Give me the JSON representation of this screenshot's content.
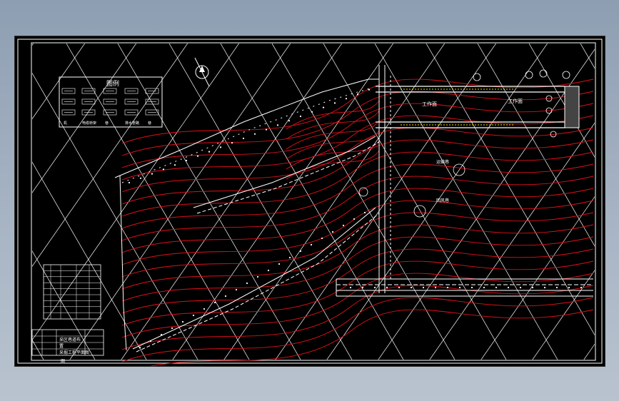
{
  "legend": {
    "title": "图例",
    "captions": [
      "机",
      "电缆桥架",
      "巷",
      "排水管路",
      "巷"
    ]
  },
  "roadway_labels": {
    "workface_1": "工作面",
    "workface_2": "工作面",
    "label_a": "运输巷",
    "label_b": "回风巷"
  },
  "title_block": {
    "line1": "采区巷道布",
    "line2": "置",
    "line3": "采掘工程平面图",
    "mark": "图"
  },
  "colors": {
    "background": "#000000",
    "contour": "#e0101a",
    "grid": "#ffffff",
    "roadway": "#ffffff",
    "accent_yellow": "#e8e000"
  }
}
